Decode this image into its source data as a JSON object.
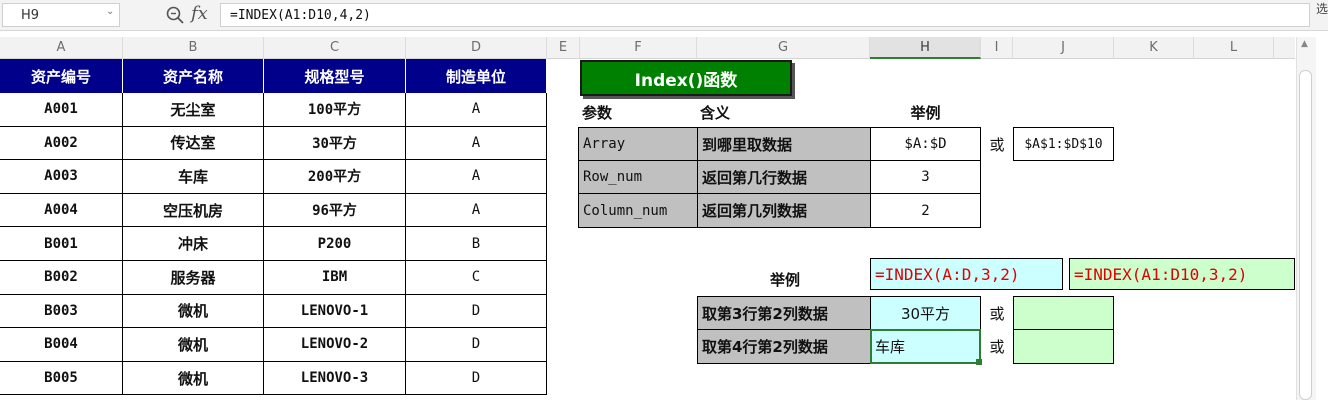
{
  "formula_bar": {
    "name_box": "H9",
    "fx": "fx",
    "formula": "=INDEX(A1:D10,4,2)",
    "edge_char": "选"
  },
  "columns": [
    "A",
    "B",
    "C",
    "D",
    "E",
    "F",
    "G",
    "H",
    "I",
    "J",
    "K",
    "L"
  ],
  "selected_column": "H",
  "left_table": {
    "headers": [
      "资产编号",
      "资产名称",
      "规格型号",
      "制造单位"
    ],
    "rows": [
      [
        "A001",
        "无尘室",
        "100平方",
        "A"
      ],
      [
        "A002",
        "传达室",
        "30平方",
        "A"
      ],
      [
        "A003",
        "车库",
        "200平方",
        "A"
      ],
      [
        "A004",
        "空压机房",
        "96平方",
        "A"
      ],
      [
        "B001",
        "冲床",
        "P200",
        "B"
      ],
      [
        "B002",
        "服务器",
        "IBM",
        "C"
      ],
      [
        "B003",
        "微机",
        "LENOVO-1",
        "D"
      ],
      [
        "B004",
        "微机",
        "LENOVO-2",
        "D"
      ],
      [
        "B005",
        "微机",
        "LENOVO-3",
        "D"
      ]
    ]
  },
  "index_panel": {
    "title": "Index()函数",
    "header_param": "参数",
    "header_meaning": "含义",
    "header_example": "举例",
    "params": [
      {
        "name": "Array",
        "meaning": "到哪里取数据",
        "example": "$A:$D"
      },
      {
        "name": "Row_num",
        "meaning": "返回第几行数据",
        "example": "3"
      },
      {
        "name": "Column_num",
        "meaning": "返回第几列数据",
        "example": "2"
      }
    ],
    "or_text": "或",
    "array_alt": "$A$1:$D$10",
    "example_label": "举例",
    "formula_1": "=INDEX(A:D,3,2)",
    "formula_2": "=INDEX(A1:D10,3,2)",
    "examples": [
      {
        "label": "取第3行第2列数据",
        "result": "30平方",
        "alt_result": ""
      },
      {
        "label": "取第4行第2列数据",
        "result": "车库",
        "alt_result": ""
      }
    ]
  }
}
